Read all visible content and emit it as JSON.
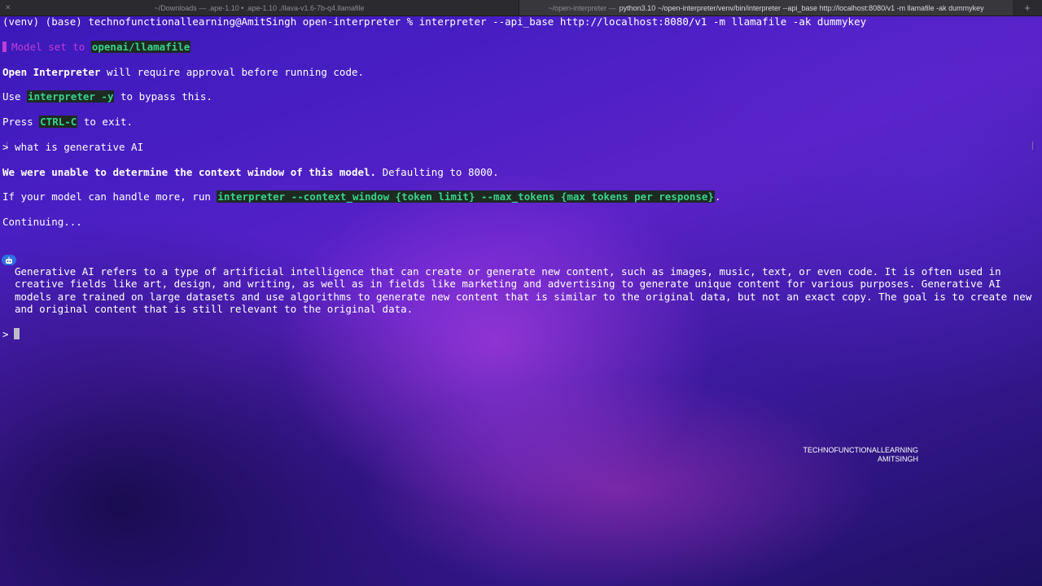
{
  "tabs": [
    {
      "title": "~/Downloads — .ape-1.10 • .ape-1.10 ./llava-v1.6-7b-q4.llamafile",
      "active": false
    },
    {
      "prefix": "~/open-interpreter — ",
      "title": "python3.10 ~/open-interpreter/venv/bin/interpreter --api_base http://localhost:8080/v1 -m llamafile -ak dummykey",
      "active": true
    }
  ],
  "tab_add_glyph": "+",
  "terminal": {
    "prompt_line": "(venv) (base) technofunctionallearning@AmitSingh open-interpreter % interpreter --api_base http://localhost:8080/v1 -m llamafile -ak dummykey",
    "model_line": {
      "prefix": "Model set to ",
      "value": "openai/llamafile"
    },
    "approval_line": {
      "bold": "Open Interpreter",
      "rest": " will require approval before running code."
    },
    "bypass_line": {
      "prefix": "Use ",
      "code": "interpreter -y",
      "suffix": " to bypass this."
    },
    "exit_line": {
      "prefix": "Press ",
      "code": "CTRL-C",
      "suffix": " to exit."
    },
    "user_query": "> what is generative AI",
    "context_line": {
      "bold": "We were unable to determine the context window of this model.",
      "rest": " Defaulting to 8000."
    },
    "handle_line": {
      "prefix": "If your model can handle more, run ",
      "code": "interpreter --context_window {token limit} --max_tokens {max tokens per response}",
      "suffix": "."
    },
    "continuing": "Continuing...",
    "response": "Generative AI refers to a type of artificial intelligence that can create or generate new content, such as images, music, text, or even code. It is often used in creative fields like art, design, and writing, as well as in fields like marketing and advertising to generate unique content for various purposes. Generative AI models are trained on large datasets and use algorithms to generate new content that is similar to the original data, but not an exact copy. The goal is to create new and original content that is still relevant to the original data.",
    "input_prompt": ">"
  },
  "watermark": {
    "line1": "TECHNOFUNCTIONALLEARNING",
    "line2": "AMITSINGH"
  },
  "colors": {
    "accent_green": "#3ad28a",
    "accent_magenta": "#c23bd8",
    "bot_blue": "#2f6fe0"
  },
  "icons": {
    "tab_close": "close-icon",
    "bot": "robot-icon",
    "cursor": "text-cursor"
  }
}
